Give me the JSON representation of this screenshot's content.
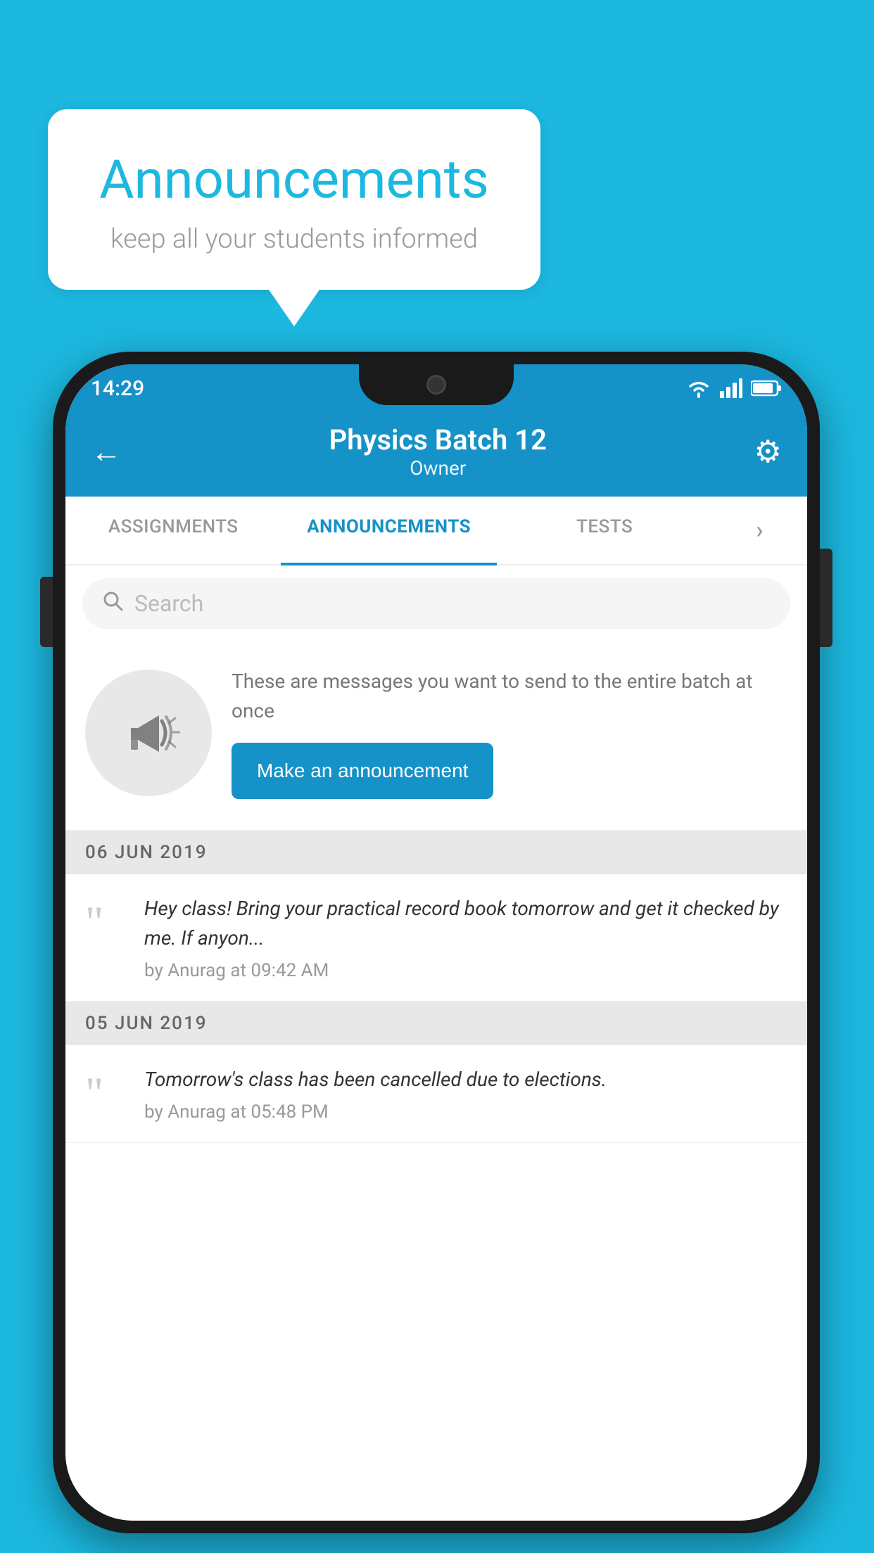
{
  "background_color": "#1cb8e0",
  "speech_bubble": {
    "title": "Announcements",
    "subtitle": "keep all your students informed"
  },
  "status_bar": {
    "time": "14:29"
  },
  "app_header": {
    "title": "Physics Batch 12",
    "subtitle": "Owner",
    "back_label": "←",
    "gear_label": "⚙"
  },
  "tabs": [
    {
      "label": "ASSIGNMENTS",
      "active": false
    },
    {
      "label": "ANNOUNCEMENTS",
      "active": true
    },
    {
      "label": "TESTS",
      "active": false
    },
    {
      "label": "···",
      "active": false
    }
  ],
  "search": {
    "placeholder": "Search"
  },
  "promo": {
    "description": "These are messages you want to send to the entire batch at once",
    "button_label": "Make an announcement"
  },
  "announcement_groups": [
    {
      "date": "06  JUN  2019",
      "items": [
        {
          "text": "Hey class! Bring your practical record book tomorrow and get it checked by me. If anyon...",
          "meta": "by Anurag at 09:42 AM"
        }
      ]
    },
    {
      "date": "05  JUN  2019",
      "items": [
        {
          "text": "Tomorrow's class has been cancelled due to elections.",
          "meta": "by Anurag at 05:48 PM"
        }
      ]
    }
  ]
}
